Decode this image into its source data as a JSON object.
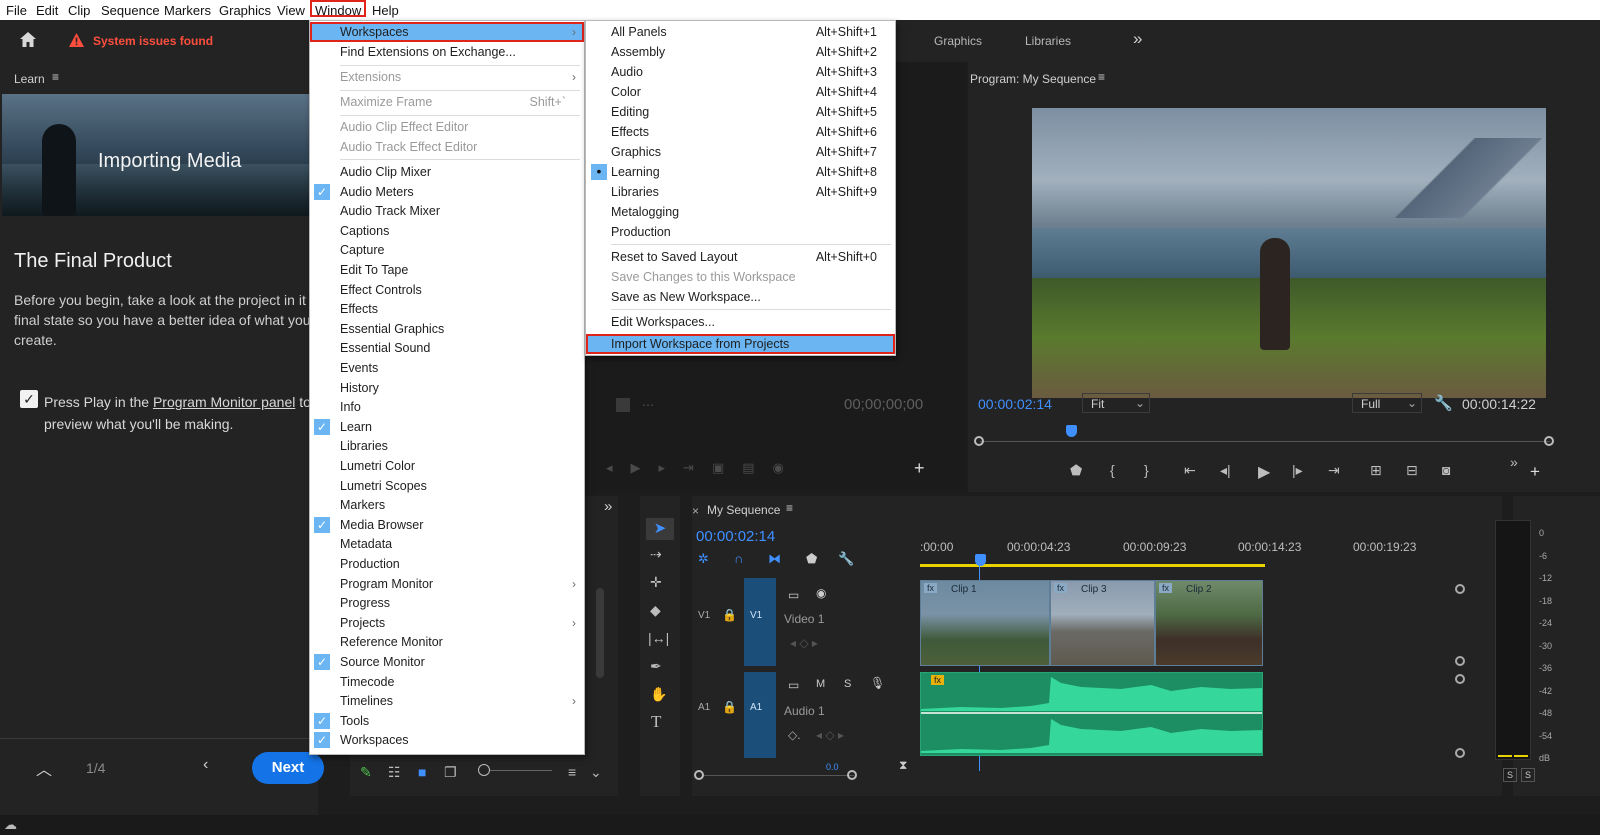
{
  "menubar": {
    "items": [
      "File",
      "Edit",
      "Clip",
      "Sequence",
      "Markers",
      "Graphics",
      "View",
      "Window",
      "Help"
    ]
  },
  "header": {
    "warning": "System issues found",
    "workspace_tabs": [
      "Graphics",
      "Libraries"
    ],
    "more": "»"
  },
  "learn_panel": {
    "tab": "Learn",
    "hero_title": "Importing Media",
    "heading": "The Final Product",
    "body": "Before you begin, take a look at the project in it final state so you have a better idea of what you create.",
    "checklist": {
      "text_pre": "Press Play in the ",
      "link": "Program Monitor panel",
      "text_post": " to",
      "line2": "preview what you'll be making."
    },
    "pager": "1/4",
    "next_label": "Next"
  },
  "window_menu": {
    "items": [
      {
        "label": "Workspaces",
        "submenu": true,
        "highlighted": true
      },
      {
        "label": "Find Extensions on Exchange..."
      },
      {
        "label": "Extensions",
        "submenu": true,
        "disabled": true
      },
      {
        "label": "Maximize Frame",
        "shortcut": "Shift+`",
        "disabled": true
      },
      {
        "label": "Audio Clip Effect Editor",
        "disabled": true
      },
      {
        "label": "Audio Track Effect Editor",
        "disabled": true
      },
      {
        "label": "Audio Clip Mixer"
      },
      {
        "label": "Audio Meters",
        "checked": true
      },
      {
        "label": "Audio Track Mixer"
      },
      {
        "label": "Captions"
      },
      {
        "label": "Capture"
      },
      {
        "label": "Edit To Tape"
      },
      {
        "label": "Effect Controls"
      },
      {
        "label": "Effects"
      },
      {
        "label": "Essential Graphics"
      },
      {
        "label": "Essential Sound"
      },
      {
        "label": "Events"
      },
      {
        "label": "History"
      },
      {
        "label": "Info"
      },
      {
        "label": "Learn",
        "checked": true
      },
      {
        "label": "Libraries"
      },
      {
        "label": "Lumetri Color"
      },
      {
        "label": "Lumetri Scopes"
      },
      {
        "label": "Markers"
      },
      {
        "label": "Media Browser",
        "checked": true
      },
      {
        "label": "Metadata"
      },
      {
        "label": "Production"
      },
      {
        "label": "Program Monitor",
        "submenu": true
      },
      {
        "label": "Progress"
      },
      {
        "label": "Projects",
        "submenu": true
      },
      {
        "label": "Reference Monitor"
      },
      {
        "label": "Source Monitor",
        "checked": true
      },
      {
        "label": "Timecode"
      },
      {
        "label": "Timelines",
        "submenu": true
      },
      {
        "label": "Tools",
        "checked": true
      },
      {
        "label": "Workspaces",
        "checked": true
      }
    ]
  },
  "workspaces_menu": {
    "items": [
      {
        "label": "All Panels",
        "shortcut": "Alt+Shift+1"
      },
      {
        "label": "Assembly",
        "shortcut": "Alt+Shift+2"
      },
      {
        "label": "Audio",
        "shortcut": "Alt+Shift+3"
      },
      {
        "label": "Color",
        "shortcut": "Alt+Shift+4"
      },
      {
        "label": "Editing",
        "shortcut": "Alt+Shift+5"
      },
      {
        "label": "Effects",
        "shortcut": "Alt+Shift+6"
      },
      {
        "label": "Graphics",
        "shortcut": "Alt+Shift+7"
      },
      {
        "label": "Learning",
        "shortcut": "Alt+Shift+8",
        "active": true
      },
      {
        "label": "Libraries",
        "shortcut": "Alt+Shift+9"
      },
      {
        "label": "Metalogging"
      },
      {
        "label": "Production"
      },
      {
        "label": "Reset to Saved Layout",
        "shortcut": "Alt+Shift+0"
      },
      {
        "label": "Save Changes to this Workspace",
        "disabled": true
      },
      {
        "label": "Save as New Workspace..."
      },
      {
        "label": "Edit Workspaces..."
      },
      {
        "label": "Import Workspace from Projects",
        "highlighted": true
      }
    ]
  },
  "source_monitor": {
    "timecode": "00;00;00;00"
  },
  "program_monitor": {
    "title": "Program: My Sequence",
    "timecode": "00:00:02:14",
    "fit": "Fit",
    "quality": "Full",
    "duration": "00:00:14:22"
  },
  "timeline": {
    "sequence_name": "My Sequence",
    "timecode": "00:00:02:14",
    "ruler": [
      ":00:00",
      "00:00:04:23",
      "00:00:09:23",
      "00:00:14:23",
      "00:00:19:23"
    ],
    "video_track": {
      "id": "V1",
      "name": "Video 1"
    },
    "audio_track": {
      "id": "A1",
      "name": "Audio 1",
      "m": "M",
      "s": "S"
    },
    "clips": [
      "Clip 1",
      "Clip 3",
      "Clip 2"
    ],
    "zoom_value": "0.0"
  },
  "audio_meter": {
    "scale": [
      "0",
      "-6",
      "-12",
      "-18",
      "-24",
      "-30",
      "-36",
      "-42",
      "-48",
      "-54",
      "dB"
    ],
    "solo": [
      "S",
      "S"
    ]
  },
  "colors": {
    "accent_blue": "#1473e6",
    "timecode_blue": "#3f8fff",
    "highlight_red": "#e0241b",
    "menu_highlight": "#6bb6f2",
    "audio_green": "#2ec88e"
  }
}
